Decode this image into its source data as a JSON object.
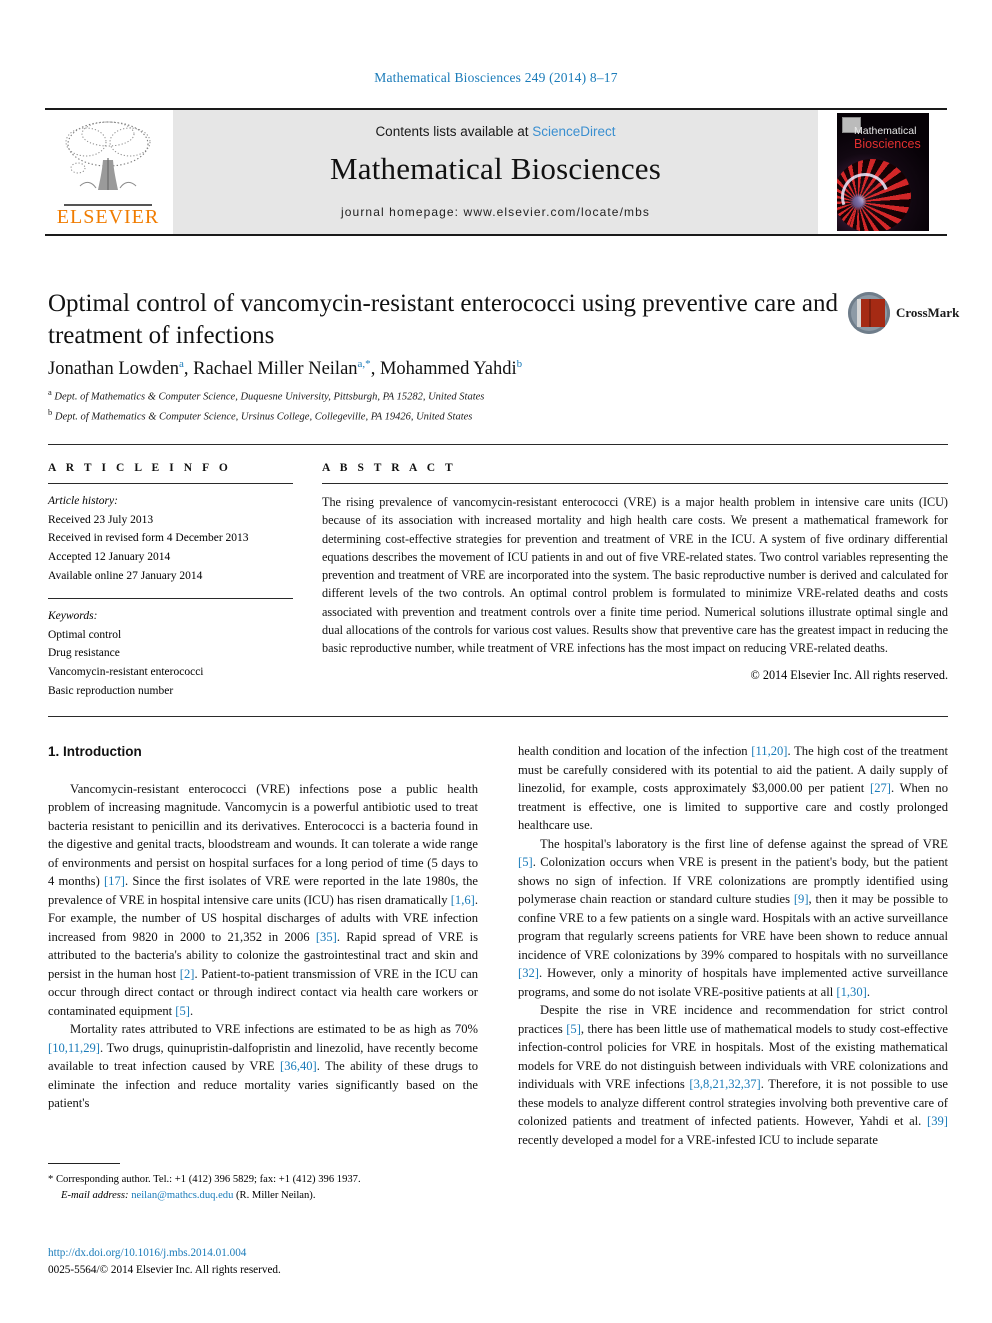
{
  "runhead": "Mathematical Biosciences 249 (2014) 8–17",
  "masthead": {
    "contents_prefix": "Contents lists available at ",
    "sciencedirect": "ScienceDirect",
    "journal_name": "Mathematical Biosciences",
    "homepage": "journal homepage: www.elsevier.com/locate/mbs",
    "publisher_logo_text": "ELSEVIER",
    "cover_title_line1": "Mathematical",
    "cover_title_line2": "Biosciences",
    "accent_blue": "#1a7bb9",
    "accent_orange": "#f07c00"
  },
  "article": {
    "title": "Optimal control of vancomycin-resistant enterococci using preventive care and treatment of infections",
    "crossmark_label": "CrossMark",
    "authors_html": "Jonathan Lowden <sup>a</sup>, Rachael Miller Neilan <sup>a,*</sup>, Mohammed Yahdi <sup>b</sup>",
    "affiliation_a": "Dept. of Mathematics & Computer Science, Duquesne University, Pittsburgh, PA 15282, United States",
    "affiliation_b": "Dept. of Mathematics & Computer Science, Ursinus College, Collegeville, PA 19426, United States",
    "affil_marker_a": "a",
    "affil_marker_b": "b"
  },
  "article_info": {
    "heading": "A R T I C L E   I N F O",
    "history_label": "Article history:",
    "history": [
      "Received 23 July 2013",
      "Received in revised form 4 December 2013",
      "Accepted 12 January 2014",
      "Available online 27 January 2014"
    ],
    "keywords_label": "Keywords:",
    "keywords": [
      "Optimal control",
      "Drug resistance",
      "Vancomycin-resistant enterococci",
      "Basic reproduction number"
    ]
  },
  "abstract": {
    "heading": "A B S T R A C T",
    "text": "The rising prevalence of vancomycin-resistant enterococci (VRE) is a major health problem in intensive care units (ICU) because of its association with increased mortality and high health care costs. We present a mathematical framework for determining cost-effective strategies for prevention and treatment of VRE in the ICU. A system of five ordinary differential equations describes the movement of ICU patients in and out of five VRE-related states. Two control variables representing the prevention and treatment of VRE are incorporated into the system. The basic reproductive number is derived and calculated for different levels of the two controls. An optimal control problem is formulated to minimize VRE-related deaths and costs associated with prevention and treatment controls over a finite time period. Numerical solutions illustrate optimal single and dual allocations of the controls for various cost values. Results show that preventive care has the greatest impact in reducing the basic reproductive number, while treatment of VRE infections has the most impact on reducing VRE-related deaths.",
    "copyright": "© 2014 Elsevier Inc. All rights reserved."
  },
  "body": {
    "section_heading": "1. Introduction",
    "left_paragraphs": [
      "Vancomycin-resistant enterococci (VRE) infections pose a public health problem of increasing magnitude. Vancomycin is a powerful antibiotic used to treat bacteria resistant to penicillin and its derivatives. Enterococci is a bacteria found in the digestive and genital tracts, bloodstream and wounds. It can tolerate a wide range of environments and persist on hospital surfaces for a long period of time (5 days to 4 months) [17]. Since the first isolates of VRE were reported in the late 1980s, the prevalence of VRE in hospital intensive care units (ICU) has risen dramatically [1,6]. For example, the number of US hospital discharges of adults with VRE infection increased from 9820 in 2000 to 21,352 in 2006 [35]. Rapid spread of VRE is attributed to the bacteria's ability to colonize the gastrointestinal tract and skin and persist in the human host [2]. Patient-to-patient transmission of VRE in the ICU can occur through direct contact or through indirect contact via health care workers or contaminated equipment [5].",
      "Mortality rates attributed to VRE infections are estimated to be as high as 70% [10,11,29]. Two drugs, quinupristin-dalfopristin and linezolid, have recently become available to treat infection caused by VRE [36,40]. The ability of these drugs to eliminate the infection and reduce mortality varies significantly based on the patient's"
    ],
    "right_paragraphs": [
      "health condition and location of the infection [11,20]. The high cost of the treatment must be carefully considered with its potential to aid the patient. A daily supply of linezolid, for example, costs approximately $3,000.00 per patient [27]. When no treatment is effective, one is limited to supportive care and costly prolonged healthcare use.",
      "The hospital's laboratory is the first line of defense against the spread of VRE [5]. Colonization occurs when VRE is present in the patient's body, but the patient shows no sign of infection. If VRE colonizations are promptly identified using polymerase chain reaction or standard culture studies [9], then it may be possible to confine VRE to a few patients on a single ward. Hospitals with an active surveillance program that regularly screens patients for VRE have been shown to reduce annual incidence of VRE colonizations by 39% compared to hospitals with no surveillance [32]. However, only a minority of hospitals have implemented active surveillance programs, and some do not isolate VRE-positive patients at all [1,30].",
      "Despite the rise in VRE incidence and recommendation for strict control practices [5], there has been little use of mathematical models to study cost-effective infection-control policies for VRE in hospitals. Most of the existing mathematical models for VRE do not distinguish between individuals with VRE colonizations and individuals with VRE infections [3,8,21,32,37]. Therefore, it is not possible to use these models to analyze different control strategies involving both preventive care of colonized patients and treatment of infected patients. However, Yahdi et al. [39] recently developed a model for a VRE-infested ICU to include separate"
    ]
  },
  "footnotes": {
    "corresponding_marker": "*",
    "corresponding": "Corresponding author. Tel.: +1 (412) 396 5829; fax: +1 (412) 396 1937.",
    "email_label": "E-mail address:",
    "email": "neilan@mathcs.duq.edu",
    "email_attrib": "(R. Miller Neilan).",
    "doi": "http://dx.doi.org/10.1016/j.mbs.2014.01.004",
    "issn_line": "0025-5564/© 2014 Elsevier Inc. All rights reserved."
  }
}
